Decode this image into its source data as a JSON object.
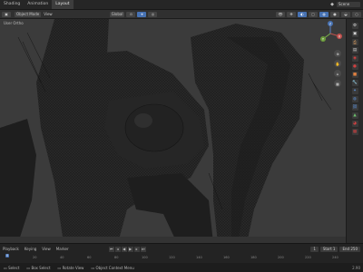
{
  "topbar": {
    "tabs": [
      {
        "label": "Shading"
      },
      {
        "label": "Animation"
      },
      {
        "label": "Layout"
      }
    ],
    "scene_label": "Scene"
  },
  "header": {
    "mode": "Object Mode",
    "view_menu": "View",
    "global": "Global",
    "view_label": "User Ortho"
  },
  "gizmo": {
    "x": "X",
    "y": "Y",
    "z": "Z"
  },
  "timeline": {
    "playback": "Playback",
    "keying": "Keying",
    "view": "View",
    "marker": "Marker",
    "current_frame": "1",
    "start_label": "Start",
    "start": "1",
    "end_label": "End",
    "end": "250",
    "ruler": [
      "0",
      "20",
      "40",
      "60",
      "80",
      "100",
      "120",
      "140",
      "160",
      "180",
      "200",
      "220",
      "240"
    ]
  },
  "status": {
    "select": "Select",
    "box_select": "Box Select",
    "rotate_view": "Rotate View",
    "context_menu": "Object Context Menu",
    "version": "2.90"
  },
  "colors": {
    "accent": "#4772b3",
    "viewport_bg": "#3a3a3a",
    "mesh": "#1b1b1b"
  }
}
